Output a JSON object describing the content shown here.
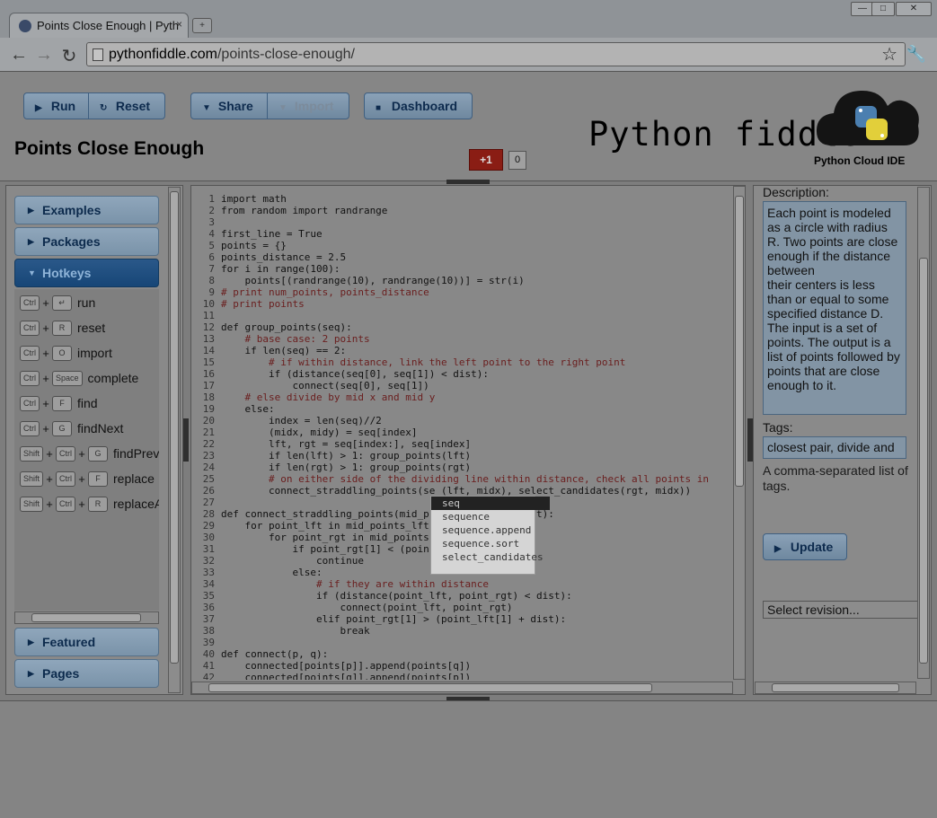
{
  "browser": {
    "tab_title": "Points Close Enough | Pyth",
    "close_glyph": "×",
    "url_domain": "pythonfiddle.com",
    "url_path": "/points-close-enough/"
  },
  "toolbar": {
    "run": "Run",
    "reset": "Reset",
    "share": "Share",
    "import": "Import",
    "dashboard": "Dashboard"
  },
  "page": {
    "title": "Points Close Enough",
    "brand": "Python fiddle",
    "brand_sub": "Python Cloud IDE",
    "gplus": "+1",
    "gplus_count": "0"
  },
  "sidebar": {
    "sections": {
      "examples": "Examples",
      "packages": "Packages",
      "hotkeys": "Hotkeys",
      "featured": "Featured",
      "pages": "Pages"
    },
    "hotkeys": [
      {
        "keys": [
          "Ctrl",
          "↵"
        ],
        "label": "run"
      },
      {
        "keys": [
          "Ctrl",
          "R"
        ],
        "label": "reset"
      },
      {
        "keys": [
          "Ctrl",
          "O"
        ],
        "label": "import"
      },
      {
        "keys": [
          "Ctrl",
          "Space"
        ],
        "label": "complete"
      },
      {
        "keys": [
          "Ctrl",
          "F"
        ],
        "label": "find"
      },
      {
        "keys": [
          "Ctrl",
          "G"
        ],
        "label": "findNext"
      },
      {
        "keys": [
          "Shift",
          "Ctrl",
          "G"
        ],
        "label": "findPrev"
      },
      {
        "keys": [
          "Shift",
          "Ctrl",
          "F"
        ],
        "label": "replace"
      },
      {
        "keys": [
          "Shift",
          "Ctrl",
          "R"
        ],
        "label": "replaceAll"
      }
    ]
  },
  "editor": {
    "lines": [
      "import math",
      "from random import randrange",
      "",
      "first_line = True",
      "points = {}",
      "points_distance = 2.5",
      "for i in range(100):",
      "    points[(randrange(10), randrange(10))] = str(i)",
      "# print num_points, points_distance",
      "# print points",
      "",
      "def group_points(seq):",
      "    # base case: 2 points",
      "    if len(seq) == 2:",
      "        # if within distance, link the left point to the right point",
      "        if (distance(seq[0], seq[1]) < dist):",
      "            connect(seq[0], seq[1])",
      "    # else divide by mid x and mid y",
      "    else:",
      "        index = len(seq)//2",
      "        (midx, midy) = seq[index]",
      "        lft, rgt = seq[index:], seq[index]",
      "        if len(lft) > 1: group_points(lft)",
      "        if len(rgt) > 1: group_points(rgt)",
      "        # on either side of the dividing line within distance, check all points in",
      "        connect_straddling_points(se (lft, midx), select_candidates(rgt, midx))",
      "",
      "def connect_straddling_points(mid_p          oints_rgt):",
      "    for point_lft in mid_points_lft",
      "        for point_rgt in mid_points",
      "            if point_rgt[1] < (poin",
      "                continue",
      "            else:",
      "                # if they are within distance",
      "                if (distance(point_lft, point_rgt) < dist):",
      "                    connect(point_lft, point_rgt)",
      "                elif point_rgt[1] > (point_lft[1] + dist):",
      "                    break",
      "",
      "def connect(p, q):",
      "    connected[points[p]].append(points[q])",
      "    connected[points[q]].append(points[p])"
    ],
    "autocomplete": [
      "seq",
      "sequence",
      "sequence.append",
      "sequence.sort",
      "select_candidates"
    ]
  },
  "details": {
    "description_label": "Description:",
    "description": "Each point is modeled\nas a circle with radius\nR. Two points are close\nenough if the distance\nbetween\ntheir centers is less\nthan or equal to some\nspecified distance D.\nThe input is a set of\npoints. The output is a\nlist of points followed by\npoints that are close\nenough to it.",
    "tags_label": "Tags:",
    "tags_value": "closest pair, divide and",
    "tags_hint": "A comma-separated list of tags.",
    "update": "Update",
    "revision": "Select revision..."
  }
}
